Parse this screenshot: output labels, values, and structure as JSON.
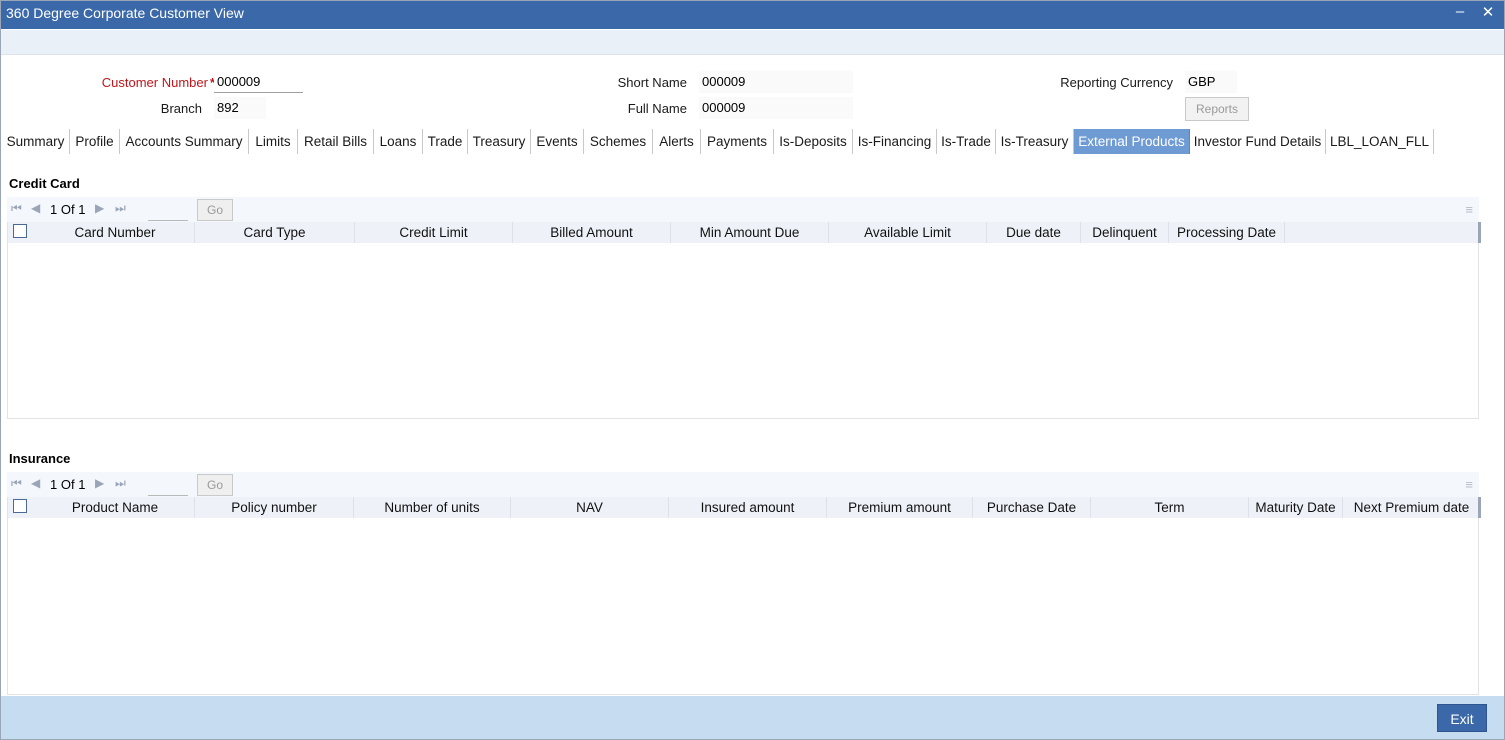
{
  "window": {
    "title": "360 Degree Corporate Customer View",
    "minimize_glyph": "–",
    "close_glyph": "✕"
  },
  "header": {
    "customer_number": {
      "label": "Customer Number",
      "value": "000009"
    },
    "branch": {
      "label": "Branch",
      "value": "892"
    },
    "short_name": {
      "label": "Short Name",
      "value": "000009"
    },
    "full_name": {
      "label": "Full Name",
      "value": "000009"
    },
    "reporting_currency": {
      "label": "Reporting Currency",
      "value": "GBP"
    },
    "reports_button": "Reports"
  },
  "tabs": [
    "Summary",
    "Profile",
    "Accounts Summary",
    "Limits",
    "Retail Bills",
    "Loans",
    "Trade",
    "Treasury",
    "Events",
    "Schemes",
    "Alerts",
    "Payments",
    "Is-Deposits",
    "Is-Financing",
    "Is-Trade",
    "Is-Treasury",
    "External Products",
    "Investor Fund Details",
    "LBL_LOAN_FLL"
  ],
  "active_tab": "External Products",
  "credit_card": {
    "title": "Credit Card",
    "pager": {
      "current": "1",
      "of_label": "Of",
      "total": "1",
      "go_label": "Go"
    },
    "columns": [
      "Card Number",
      "Card Type",
      "Credit Limit",
      "Billed Amount",
      "Min Amount Due",
      "Available Limit",
      "Due date",
      "Delinquent",
      "Processing Date"
    ]
  },
  "insurance": {
    "title": "Insurance",
    "pager": {
      "current": "1",
      "of_label": "Of",
      "total": "1",
      "go_label": "Go"
    },
    "columns": [
      "Product Name",
      "Policy number",
      "Number of units",
      "NAV",
      "Insured amount",
      "Premium amount",
      "Purchase Date",
      "Term",
      "Maturity Date",
      "Next Premium date"
    ]
  },
  "footer": {
    "exit_label": "Exit"
  },
  "colors": {
    "titlebar": "#3b68a8",
    "active_tab": "#6f9bd4",
    "footer": "#c6dcf0",
    "required": "#c0161c"
  }
}
